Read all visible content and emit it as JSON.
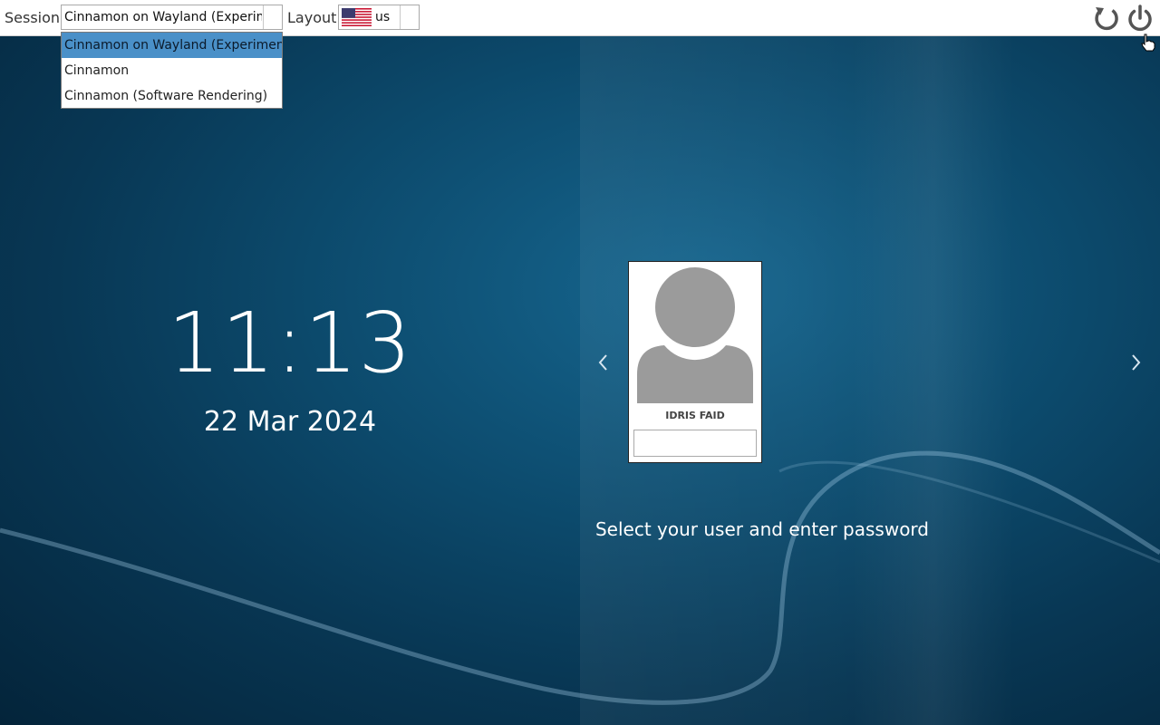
{
  "topbar": {
    "session_label": "Session",
    "session_value": "Cinnamon on Wayland (Experime",
    "layout_label": "Layout",
    "layout_value": "us",
    "reboot_icon": "restart-icon",
    "power_icon": "power-icon"
  },
  "session_menu": {
    "items": [
      {
        "label": "Cinnamon on Wayland (Experimenta",
        "selected": true
      },
      {
        "label": "Cinnamon",
        "selected": false
      },
      {
        "label": "Cinnamon (Software Rendering)",
        "selected": false
      }
    ]
  },
  "clock": {
    "time": "11:13",
    "date": "22 Mar 2024"
  },
  "user": {
    "name": "IDRIS FAID",
    "password_value": ""
  },
  "hint": "Select your user and enter password",
  "colors": {
    "accent": "#4a90c8",
    "bg_dark": "#083754",
    "bg_light": "#16668f"
  }
}
